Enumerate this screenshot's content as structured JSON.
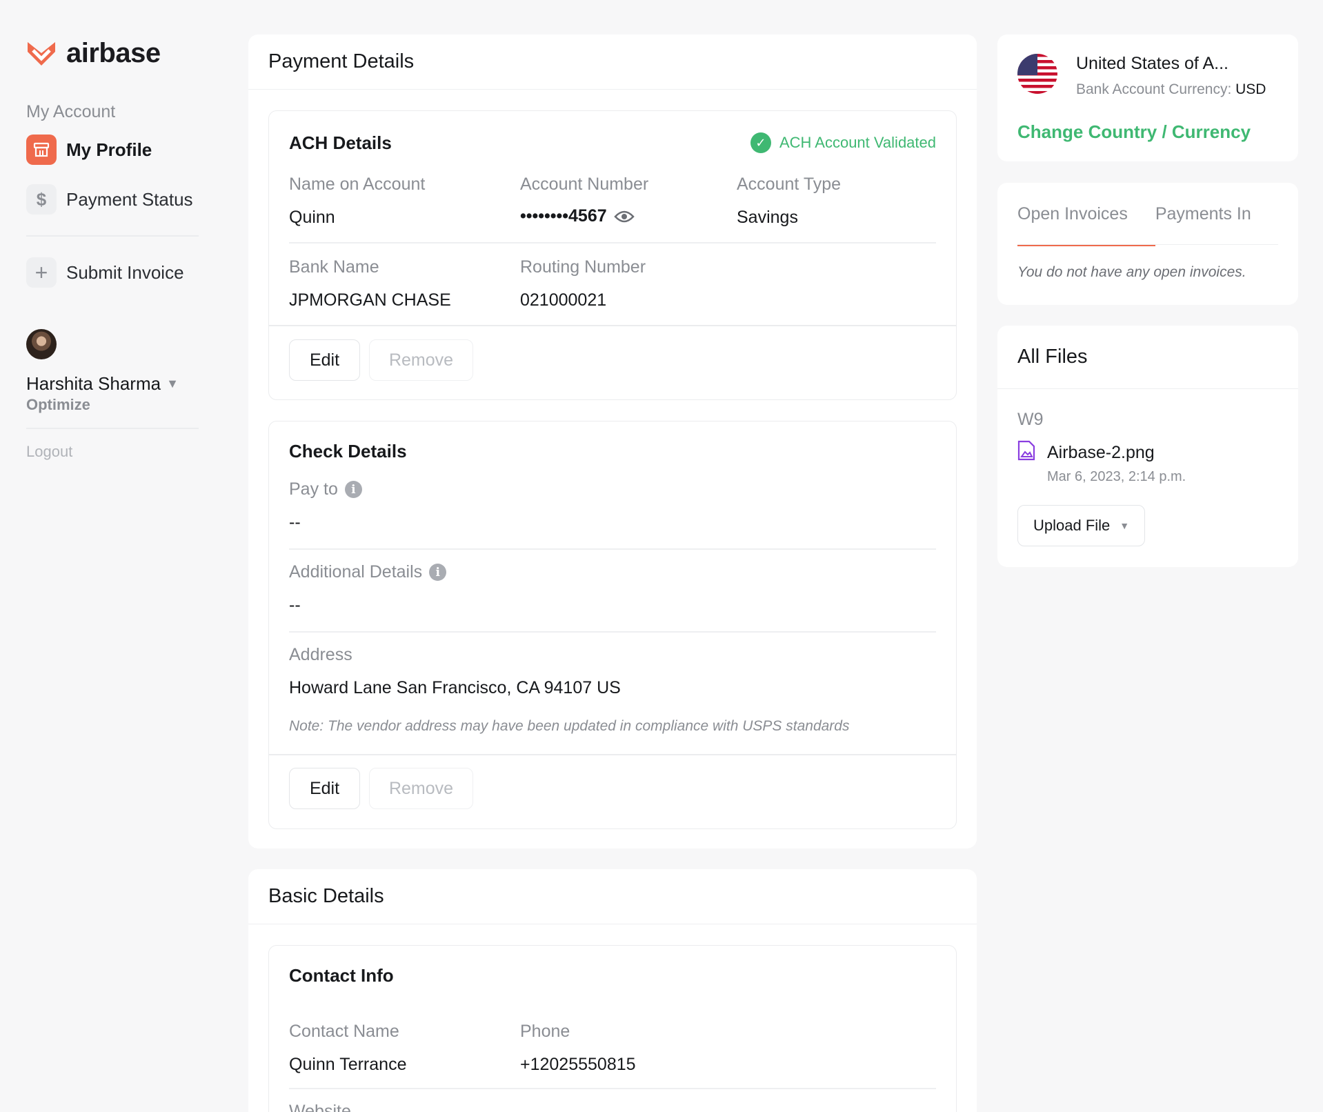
{
  "brand": {
    "name": "airbase",
    "accent": "#ef6a4c",
    "success": "#3fb872"
  },
  "sidebar": {
    "section_label": "My Account",
    "items": [
      {
        "label": "My Profile",
        "icon": "store-icon"
      },
      {
        "label": "Payment Status",
        "icon": "dollar-icon"
      },
      {
        "label": "Submit Invoice",
        "icon": "plus-icon"
      }
    ],
    "user": {
      "name": "Harshita Sharma",
      "org": "Optimize"
    },
    "logout": "Logout"
  },
  "payment_details": {
    "title": "Payment Details",
    "ach": {
      "title": "ACH Details",
      "status": "ACH Account Validated",
      "fields": {
        "name_on_account": {
          "label": "Name on Account",
          "value": "Quinn"
        },
        "account_number": {
          "label": "Account Number",
          "value": "••••••••4567"
        },
        "account_type": {
          "label": "Account Type",
          "value": "Savings"
        },
        "bank_name": {
          "label": "Bank Name",
          "value": "JPMORGAN CHASE"
        },
        "routing_number": {
          "label": "Routing Number",
          "value": "021000021"
        }
      },
      "edit": "Edit",
      "remove": "Remove"
    },
    "check": {
      "title": "Check Details",
      "pay_to": {
        "label": "Pay to",
        "value": "--"
      },
      "additional": {
        "label": "Additional Details",
        "value": "--"
      },
      "address": {
        "label": "Address",
        "value": "Howard Lane San Francisco, CA 94107 US"
      },
      "note": "Note: The vendor address may have been updated in compliance with USPS standards",
      "edit": "Edit",
      "remove": "Remove"
    }
  },
  "basic_details": {
    "title": "Basic Details",
    "contact": {
      "title": "Contact Info",
      "contact_name": {
        "label": "Contact Name",
        "value": "Quinn Terrance"
      },
      "phone": {
        "label": "Phone",
        "value": "+12025550815"
      },
      "website": {
        "label": "Website"
      }
    }
  },
  "country": {
    "name": "United States of A...",
    "currency_label": "Bank Account Currency:",
    "currency": "USD",
    "change_link": "Change Country / Currency"
  },
  "invoices": {
    "tabs": [
      "Open Invoices",
      "Payments In"
    ],
    "empty": "You do not have any open invoices."
  },
  "files": {
    "title": "All Files",
    "group": "W9",
    "file": {
      "name": "Airbase-2.png",
      "date": "Mar 6, 2023, 2:14 p.m."
    },
    "upload": "Upload File"
  }
}
